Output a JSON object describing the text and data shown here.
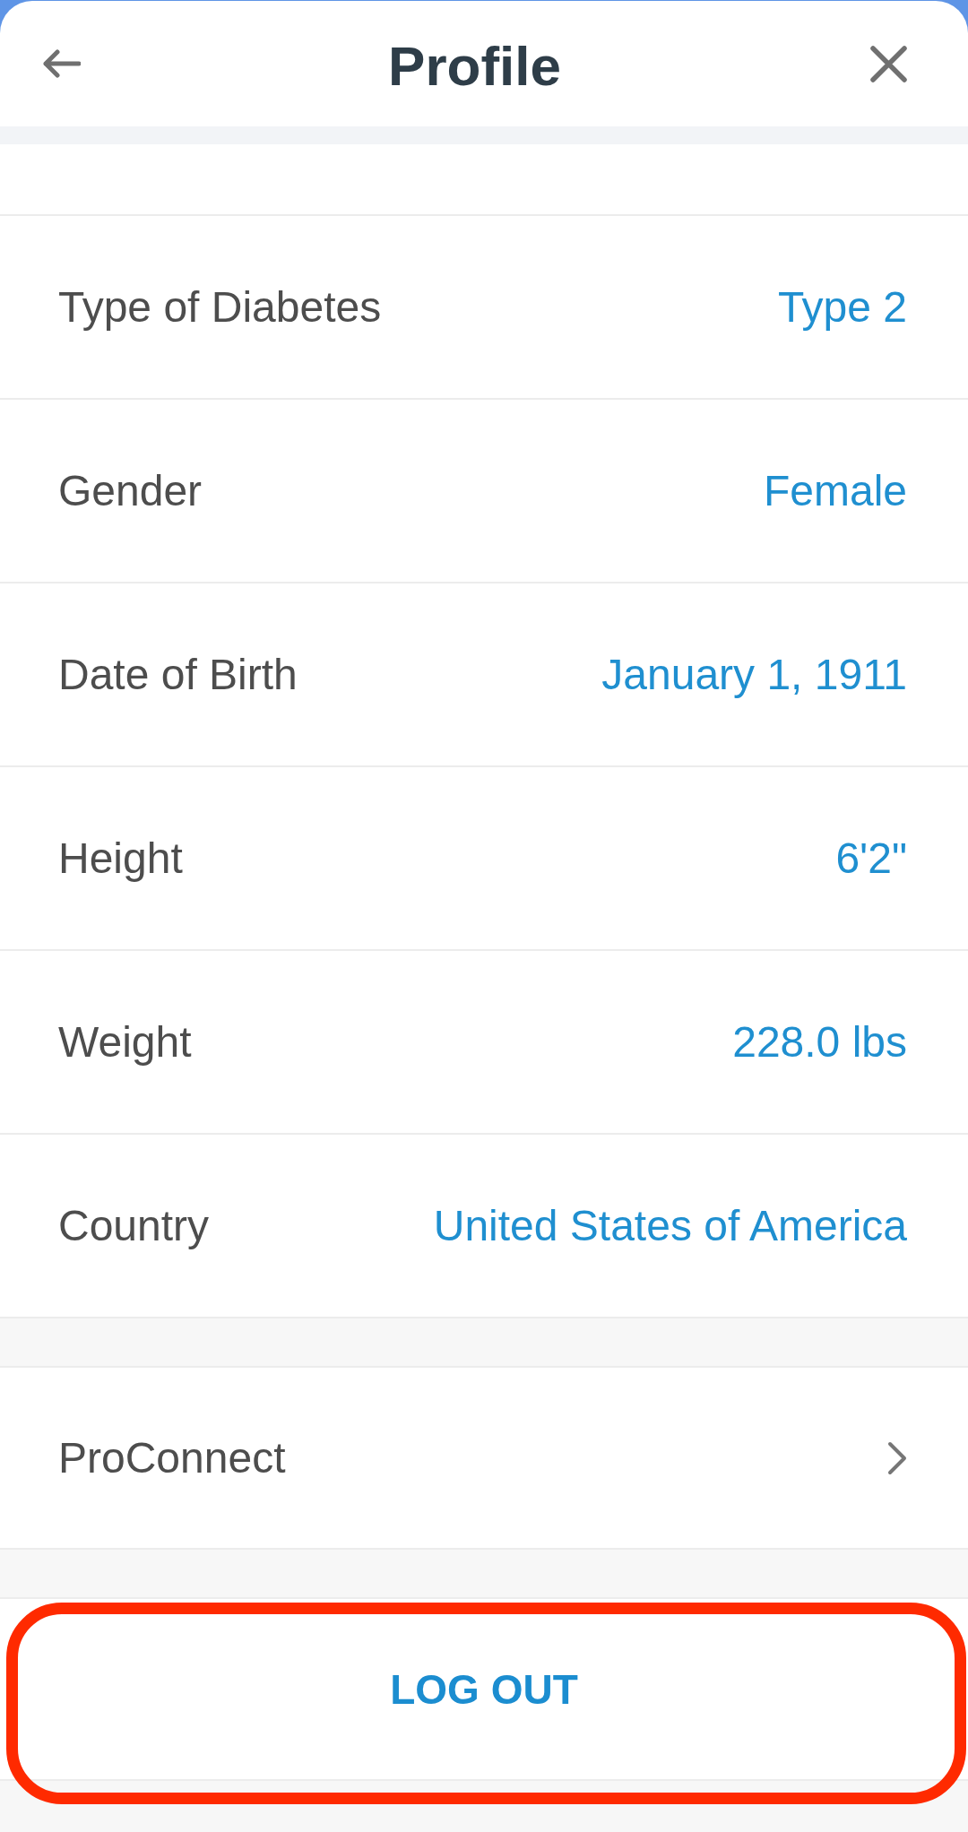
{
  "header": {
    "title": "Profile"
  },
  "fields": [
    {
      "label": "Type of Diabetes",
      "value": "Type 2"
    },
    {
      "label": "Gender",
      "value": "Female"
    },
    {
      "label": "Date of Birth",
      "value": "January 1, 1911"
    },
    {
      "label": "Height",
      "value": "6'2\""
    },
    {
      "label": "Weight",
      "value": "228.0 lbs"
    },
    {
      "label": "Country",
      "value": "United States of America"
    }
  ],
  "links": [
    {
      "label": "ProConnect"
    }
  ],
  "logout_button": {
    "label": "LOG OUT",
    "highlighted": true
  }
}
